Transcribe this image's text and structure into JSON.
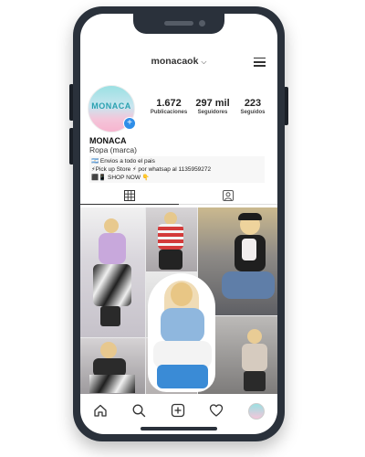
{
  "header": {
    "username": "monacaok",
    "chevron": "⌵"
  },
  "profile": {
    "avatar_text": "MONACA",
    "stats": [
      {
        "value": "1.672",
        "label": "Publicaciones"
      },
      {
        "value": "297 mil",
        "label": "Seguidores"
      },
      {
        "value": "223",
        "label": "Seguidos"
      }
    ],
    "name": "MONACA",
    "category": "Ropa (marca)",
    "bio": [
      "🇦🇷 Envios a todo el pais",
      "⚡Pick up Store ⚡ por whatsap al 1135959272",
      "⬛📱 SHOP NOW 👇"
    ]
  },
  "colors": {
    "frame": "#2a313b",
    "badge": "#2f8ee8",
    "avatar_accent": "#2aa1b0"
  },
  "tabs": [
    {
      "icon": "grid-icon",
      "active": true
    },
    {
      "icon": "tagged-icon",
      "active": false
    }
  ],
  "nav": [
    "home-icon",
    "search-icon",
    "new-post-icon",
    "heart-icon",
    "profile-avatar-icon"
  ]
}
